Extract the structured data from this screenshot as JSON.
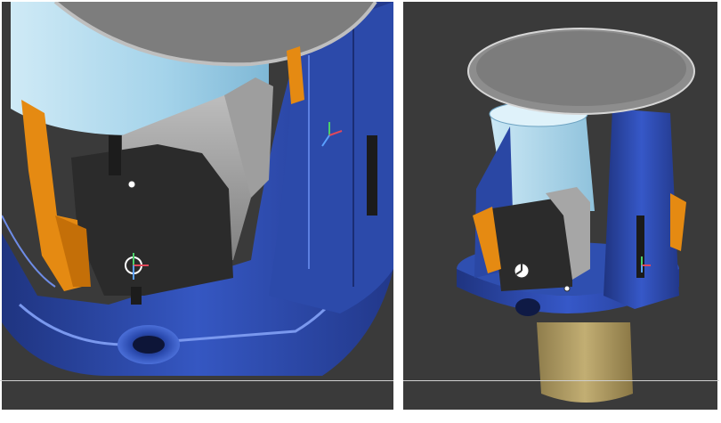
{
  "scene": {
    "views": [
      {
        "id": "closeup",
        "description_label": ""
      },
      {
        "id": "overview",
        "description_label": ""
      }
    ],
    "colors": {
      "background": "#3a3a3a",
      "housing_blue": "#2f4fb0",
      "housing_blue_dark": "#1f3480",
      "housing_blue_light": "#5c7fe0",
      "cylinder_light_blue": "#a9d6ec",
      "servo_black": "#2b2b2b",
      "gear_grey": "#9a9a9a",
      "bracket_orange": "#e58a12",
      "lid_grey": "#8d8d8d",
      "tan_cylinder": "#b9a46a"
    },
    "icons": [
      "triad-axis-icon",
      "origin-marker-icon"
    ]
  }
}
